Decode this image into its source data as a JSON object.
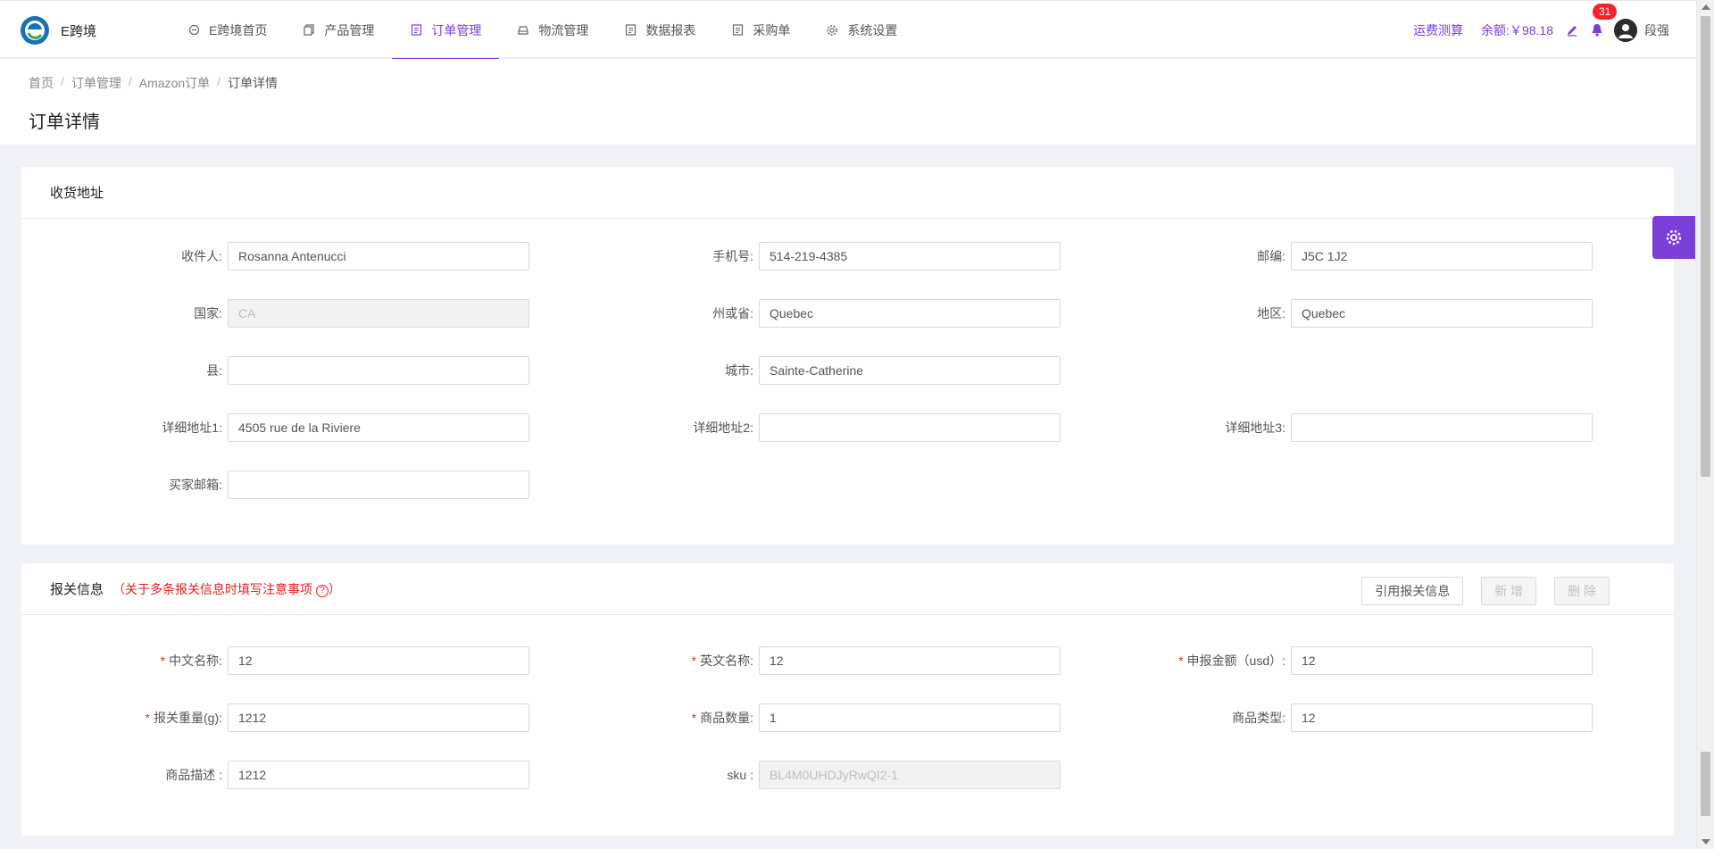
{
  "app": {
    "name": "E跨境"
  },
  "nav": [
    {
      "label": "E跨境首页",
      "icon": "home-icon"
    },
    {
      "label": "产品管理",
      "icon": "copy-icon"
    },
    {
      "label": "订单管理",
      "icon": "document-icon",
      "active": true
    },
    {
      "label": "物流管理",
      "icon": "car-icon"
    },
    {
      "label": "数据报表",
      "icon": "document-icon"
    },
    {
      "label": "采购单",
      "icon": "document-icon"
    },
    {
      "label": "系统设置",
      "icon": "gear-icon"
    }
  ],
  "header_right": {
    "freight_calc": "运费测算",
    "balance": "余额:￥98.18",
    "notification_count": "31",
    "user_name": "段强"
  },
  "breadcrumb": [
    "首页",
    "订单管理",
    "Amazon订单",
    "订单详情"
  ],
  "page_title": "订单详情",
  "address_section": {
    "title": "收货地址",
    "fields": {
      "recipient": {
        "label": "收件人:",
        "value": "Rosanna Antenucci"
      },
      "phone": {
        "label": "手机号:",
        "value": "514-219-4385"
      },
      "postcode": {
        "label": "邮编:",
        "value": "J5C 1J2"
      },
      "country": {
        "label": "国家:",
        "value": "CA"
      },
      "state": {
        "label": "州或省:",
        "value": "Quebec"
      },
      "region": {
        "label": "地区:",
        "value": "Quebec"
      },
      "county": {
        "label": "县:",
        "value": ""
      },
      "city": {
        "label": "城市:",
        "value": "Sainte-Catherine"
      },
      "address1": {
        "label": "详细地址1:",
        "value": "4505 rue de la Riviere"
      },
      "address2": {
        "label": "详细地址2:",
        "value": ""
      },
      "address3": {
        "label": "详细地址3:",
        "value": ""
      },
      "buyer_email": {
        "label": "买家邮箱:",
        "value": ""
      }
    }
  },
  "customs_section": {
    "title": "报关信息",
    "note": "（关于多条报关信息时填写注意事项",
    "note_close": "）",
    "help_glyph": "?",
    "buttons": {
      "cite": "引用报关信息",
      "add": "新 增",
      "delete": "删 除"
    },
    "fields": {
      "cn_name": {
        "label": "中文名称:",
        "value": "12"
      },
      "en_name": {
        "label": "英文名称:",
        "value": "12"
      },
      "declared_amount": {
        "label": "申报金额（usd）:",
        "value": "12"
      },
      "weight": {
        "label": "报关重量(g):",
        "value": "1212"
      },
      "quantity": {
        "label": "商品数量:",
        "value": "1"
      },
      "product_type": {
        "label": "商品类型:",
        "value": "12"
      },
      "description": {
        "label": "商品描述 :",
        "value": "1212"
      },
      "sku": {
        "label": "sku :",
        "value": "BL4M0UHDJyRwQI2-1"
      }
    }
  },
  "colors": {
    "accent": "#7a3fd8",
    "required": "#f5222d",
    "badge": "#f5222d"
  }
}
